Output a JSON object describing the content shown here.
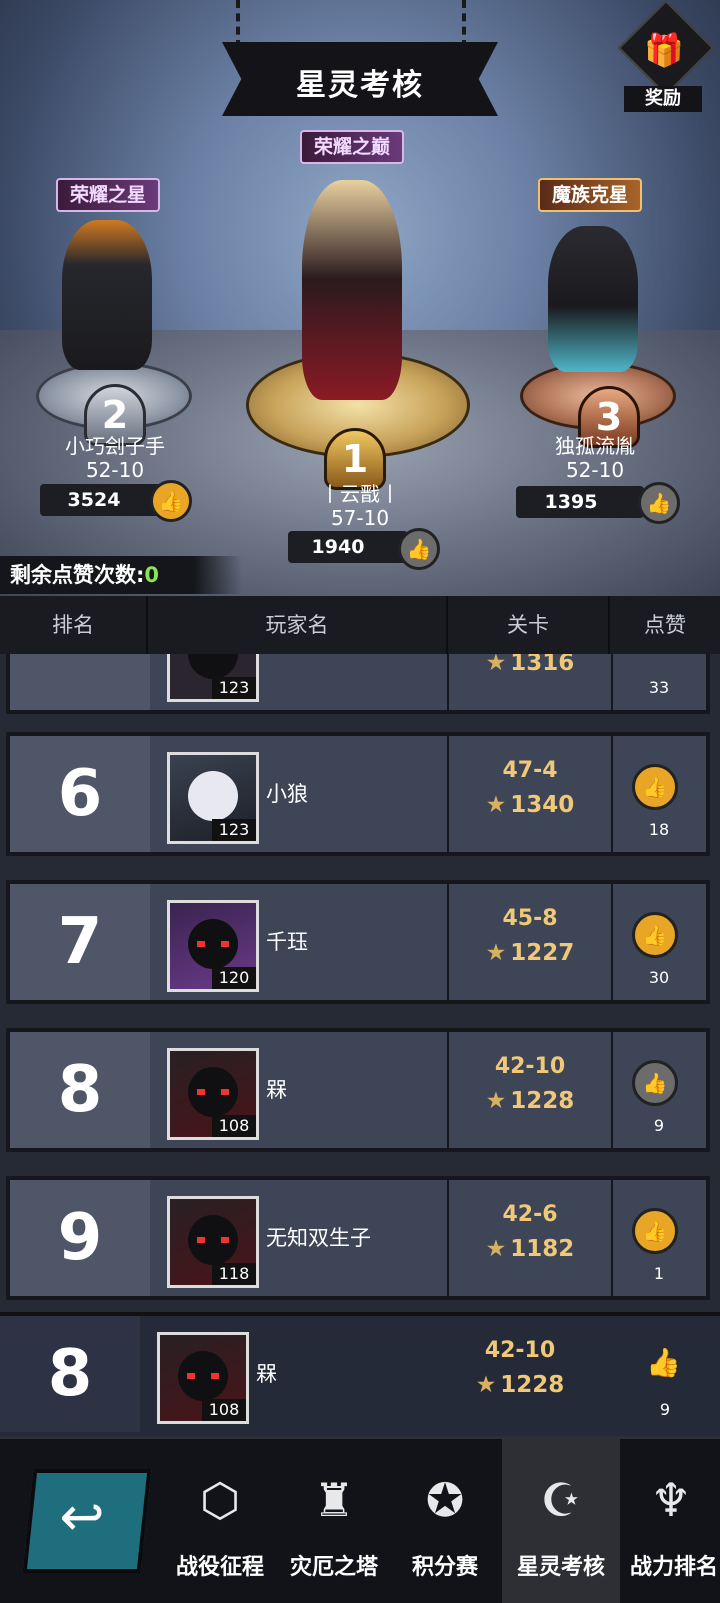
{
  "header": {
    "title": "星灵考核",
    "reward_label": "奖励"
  },
  "podium": {
    "first": {
      "title": "荣耀之巅",
      "rank": "1",
      "name": "丨云戬丨",
      "stage": "57-10",
      "likes": "1940"
    },
    "second": {
      "title": "荣耀之星",
      "rank": "2",
      "name": "小巧刽子手",
      "stage": "52-10",
      "likes": "3524"
    },
    "third": {
      "title": "魔族克星",
      "rank": "3",
      "name": "独孤流胤",
      "stage": "52-10",
      "likes": "1395"
    }
  },
  "remaining_likes": {
    "label": "剩余点赞次数:",
    "value": "0"
  },
  "table": {
    "headers": {
      "rank": "排名",
      "player": "玩家名",
      "stage": "关卡",
      "like": "点赞"
    },
    "partial_row": {
      "level": "123",
      "score": "1316",
      "likes": "33"
    },
    "rows": [
      {
        "rank": "6",
        "name": "小狼",
        "level": "123",
        "stage": "47-4",
        "score": "1340",
        "likes": "18",
        "liked": true
      },
      {
        "rank": "7",
        "name": "千珏",
        "level": "120",
        "stage": "45-8",
        "score": "1227",
        "likes": "30",
        "liked": true
      },
      {
        "rank": "8",
        "name": "槑",
        "level": "108",
        "stage": "42-10",
        "score": "1228",
        "likes": "9",
        "liked": false
      },
      {
        "rank": "9",
        "name": "无知双生子",
        "level": "118",
        "stage": "42-6",
        "score": "1182",
        "likes": "1",
        "liked": true
      }
    ],
    "self_row": {
      "rank": "8",
      "name": "槑",
      "level": "108",
      "stage": "42-10",
      "score": "1228",
      "likes": "9"
    }
  },
  "navbar": {
    "items": [
      {
        "label": "战役征程",
        "icon": "shield-icon"
      },
      {
        "label": "灾厄之塔",
        "icon": "tower-icon"
      },
      {
        "label": "积分赛",
        "icon": "star-badge-icon"
      },
      {
        "label": "星灵考核",
        "icon": "moon-star-icon",
        "active": true
      },
      {
        "label": "战力排名",
        "icon": "power-icon"
      }
    ]
  },
  "colors": {
    "gold_accent": "#e9a526",
    "stage_text": "#f0c878",
    "remaining_zero": "#8ce35a"
  }
}
